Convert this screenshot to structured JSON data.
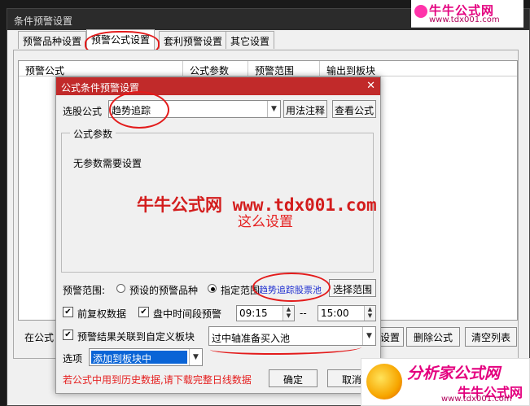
{
  "outer_window": {
    "title": "条件预警设置",
    "tabs": [
      "预警品种设置",
      "预警公式设置",
      "套利预警设置",
      "其它设置"
    ],
    "columns": [
      "预警公式",
      "公式参数",
      "预警范围",
      "输出到板块"
    ],
    "left_label": "在公式",
    "buttons": {
      "settings": "设置",
      "delete": "删除公式",
      "clear": "清空列表"
    }
  },
  "dialog": {
    "title": "公式条件预警设置",
    "close_glyph": "✕",
    "formula_label": "选股公式",
    "formula_value": "趋势追踪",
    "usage_button": "用法注释",
    "view_button": "查看公式",
    "params_group_title": "公式参数",
    "params_text": "无参数需要设置",
    "range_label": "预警范围:",
    "range_option_1": "预设的预警品种",
    "range_option_2": "指定范围",
    "range_value": "趋势追踪股票池",
    "select_range_button": "选择范围",
    "prev_adjust_label": "前复权数据",
    "intraday_label": "盘中时间段预警",
    "time_start": "09:15",
    "time_sep": "--",
    "time_end": "15:00",
    "link_label": "预警结果关联到自定义板块",
    "block_value": "过中轴准备买入池",
    "options_label": "选项",
    "options_value": "添加到板块中",
    "warning_text": "若公式中用到历史数据,请下载完整日线数据",
    "ok_button": "确定",
    "cancel_button": "取消"
  },
  "watermark": {
    "text": "牛牛公式网 www.tdx001.com",
    "note": "这么设置"
  },
  "logo_top": {
    "cn": "牛牛公式网",
    "url": "www.tdx001.com"
  },
  "logo_bottom": {
    "cn1": "分析家公式网",
    "cn2": "牛牛公式网",
    "url": "www.tdx001.com"
  },
  "colors": {
    "dialog_title": "#c12a2a",
    "annotation": "#e31b1b",
    "selection": "#0a64d6"
  }
}
